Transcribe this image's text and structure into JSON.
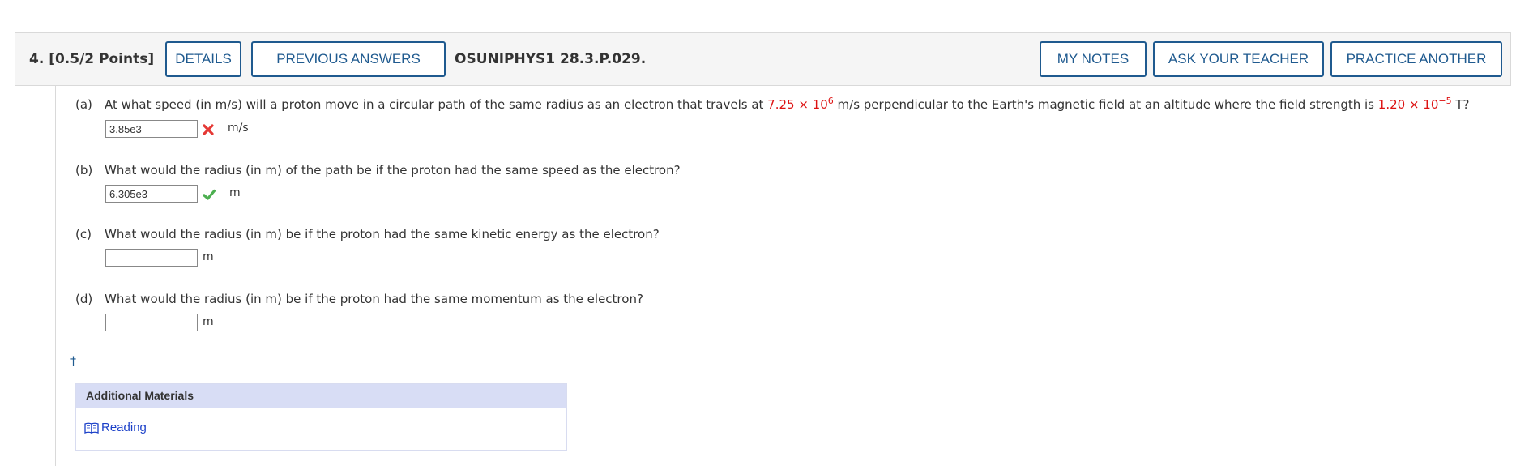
{
  "header": {
    "question_label": "4.  [0.5/2 Points]",
    "details_label": "DETAILS",
    "previous_answers_label": "PREVIOUS ANSWERS",
    "problem_id": "OSUNIPHYS1 28.3.P.029.",
    "my_notes_label": "MY NOTES",
    "ask_teacher_label": "ASK YOUR TEACHER",
    "practice_another_label": "PRACTICE ANOTHER"
  },
  "parts": [
    {
      "letter": "(a)",
      "question_pre": "At what speed (in m/s) will a proton move in a circular path of the same radius as an electron that travels at ",
      "speed_mantissa": "7.25 × 10",
      "speed_exp": "6",
      "question_mid": " m/s perpendicular to the Earth's magnetic field at an altitude where the field strength is ",
      "field_mantissa": "1.20 × 10",
      "field_exp": "−5",
      "question_post": " T?",
      "answer_value": "3.85e3",
      "status": "incorrect",
      "unit": "m/s"
    },
    {
      "letter": "(b)",
      "question": "What would the radius (in m) of the path be if the proton had the same speed as the electron?",
      "answer_value": "6.305e3",
      "status": "correct",
      "unit": "m"
    },
    {
      "letter": "(c)",
      "question": "What would the radius (in m) be if the proton had the same kinetic energy as the electron?",
      "answer_value": "",
      "unit": "m"
    },
    {
      "letter": "(d)",
      "question": "What would the radius (in m) be if the proton had the same momentum as the electron?",
      "answer_value": "",
      "unit": "m"
    }
  ],
  "footnote_marker": "†",
  "additional_materials": {
    "title": "Additional Materials",
    "reading_label": "Reading",
    "reading_icon": "book-icon"
  },
  "colors": {
    "accent": "#1f5a8f",
    "highlight_red": "#dd1111",
    "correct_green": "#4caf50",
    "incorrect_red": "#e53935",
    "materials_header": "#d8ddf5",
    "link_blue": "#1a3fc8"
  }
}
